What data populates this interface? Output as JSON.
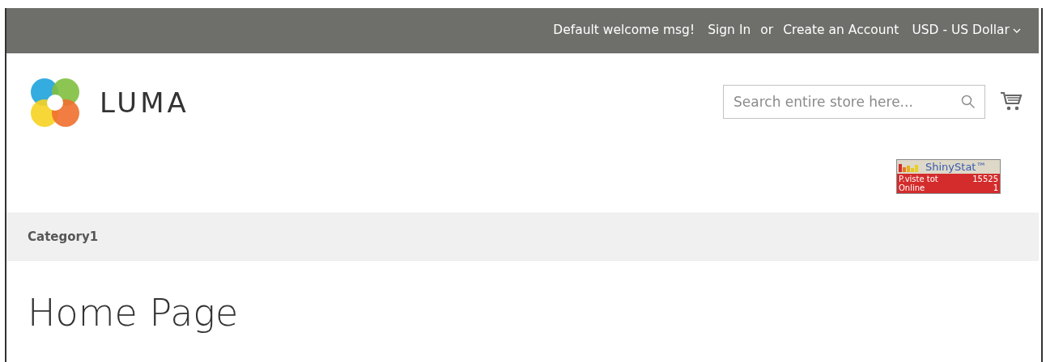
{
  "top_bar": {
    "welcome": "Default welcome msg!",
    "sign_in": "Sign In",
    "or": "or",
    "create_account": "Create an Account",
    "currency": "USD - US Dollar"
  },
  "header": {
    "logo_text": "LUMA",
    "search": {
      "placeholder": "Search entire store here..."
    }
  },
  "stat_counter": {
    "title": "ShinyStat™",
    "rows": [
      {
        "label": "P.viste tot",
        "value": "15525"
      },
      {
        "label": "Online",
        "value": "1"
      }
    ]
  },
  "nav": {
    "items": [
      "Category1"
    ]
  },
  "page_title": "Home Page"
}
